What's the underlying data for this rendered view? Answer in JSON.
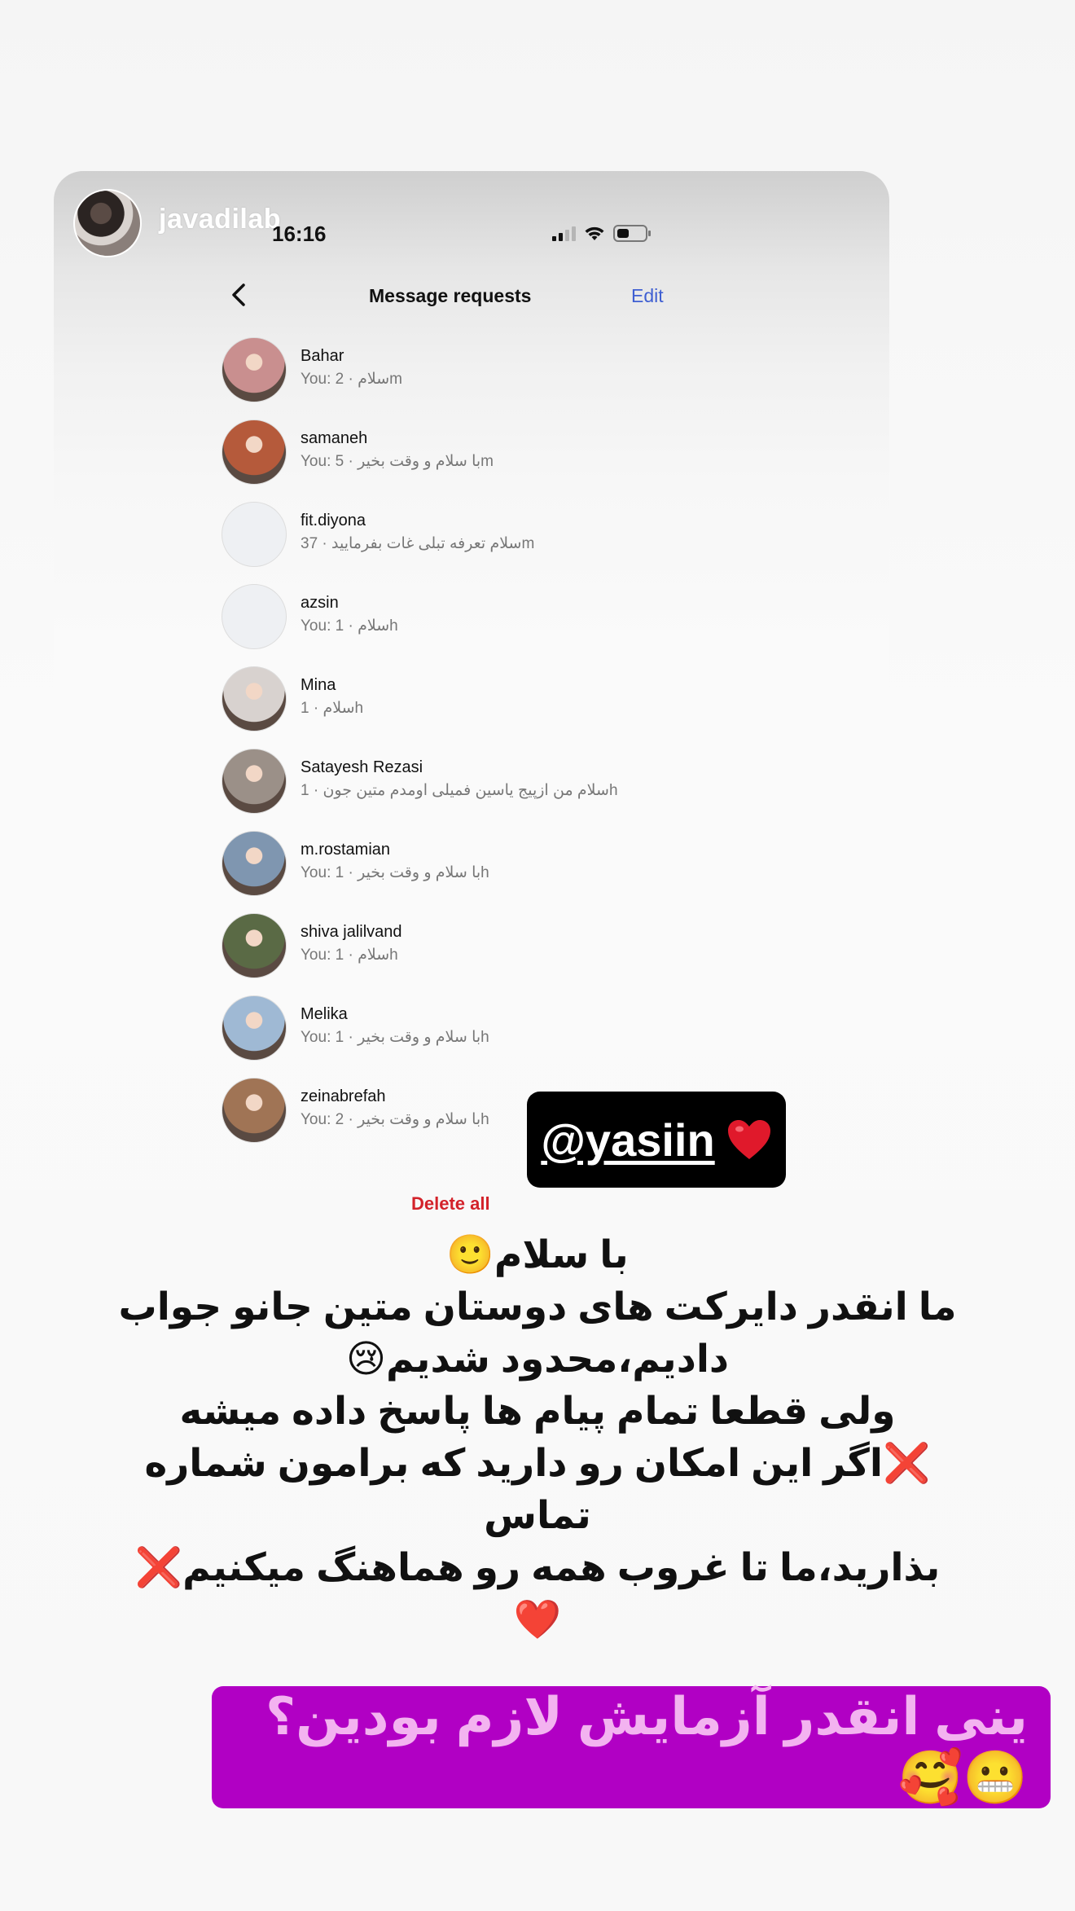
{
  "story": {
    "username": "javadilab"
  },
  "status_bar": {
    "time": "16:16"
  },
  "nav": {
    "back_icon": "chevron-left-icon",
    "title": "Message requests",
    "edit_label": "Edit"
  },
  "requests": [
    {
      "name": "Bahar",
      "preview": "You: سلام · 2m",
      "avatar_color": "#c98f8f"
    },
    {
      "name": "samaneh",
      "preview": "You: با سلام و وقت بخیر · 5m",
      "avatar_color": "#b55a3b"
    },
    {
      "name": "fit.diyona",
      "preview": "سلام تعرفه تبلی غات بفرمایید · 37m",
      "avatar_color": "#eef0f3"
    },
    {
      "name": "azsin",
      "preview": "You: سلام · 1h",
      "avatar_color": "#eef0f3"
    },
    {
      "name": "Mina",
      "preview": "سلام · 1h",
      "avatar_color": "#d8d2cf"
    },
    {
      "name": "Satayesh  Rezasi",
      "preview": "سلام من ازپیج یاسین فمیلی اومدم متین جون · 1h",
      "avatar_color": "#9b9088"
    },
    {
      "name": "m.rostamian",
      "preview": "You: با سلام و وقت بخیر · 1h",
      "avatar_color": "#7f96b0"
    },
    {
      "name": "shiva jalilvand",
      "preview": "You: سلام · 1h",
      "avatar_color": "#5a6a45"
    },
    {
      "name": "Melika",
      "preview": "You: با سلام و وقت بخیر · 1h",
      "avatar_color": "#9fb9d4"
    },
    {
      "name": "zeinabrefah",
      "preview": "You: با سلام و وقت بخیر · 2h",
      "avatar_color": "#a07455"
    }
  ],
  "delete_all_label": "Delete all",
  "sticker": {
    "text": "@yasiin",
    "icon": "heart-icon",
    "color": "#e0192b"
  },
  "message_lines": [
    "با سلام🙂",
    "ما انقدر دایرکت های دوستان متین جانو جواب",
    "دادیم،محدود شدیم😢",
    "ولی قطعا تمام پیام ها پاسخ داده میشه",
    "❌اگر این امکان رو دارید که برامون شماره تماس",
    "بذارید،ما تا غروب همه رو هماهنگ میکنیم❌❤️"
  ],
  "banner": {
    "text": "ینی انقدر آزمایش لازم بودین؟😬🥰",
    "background": "#b100c4"
  }
}
